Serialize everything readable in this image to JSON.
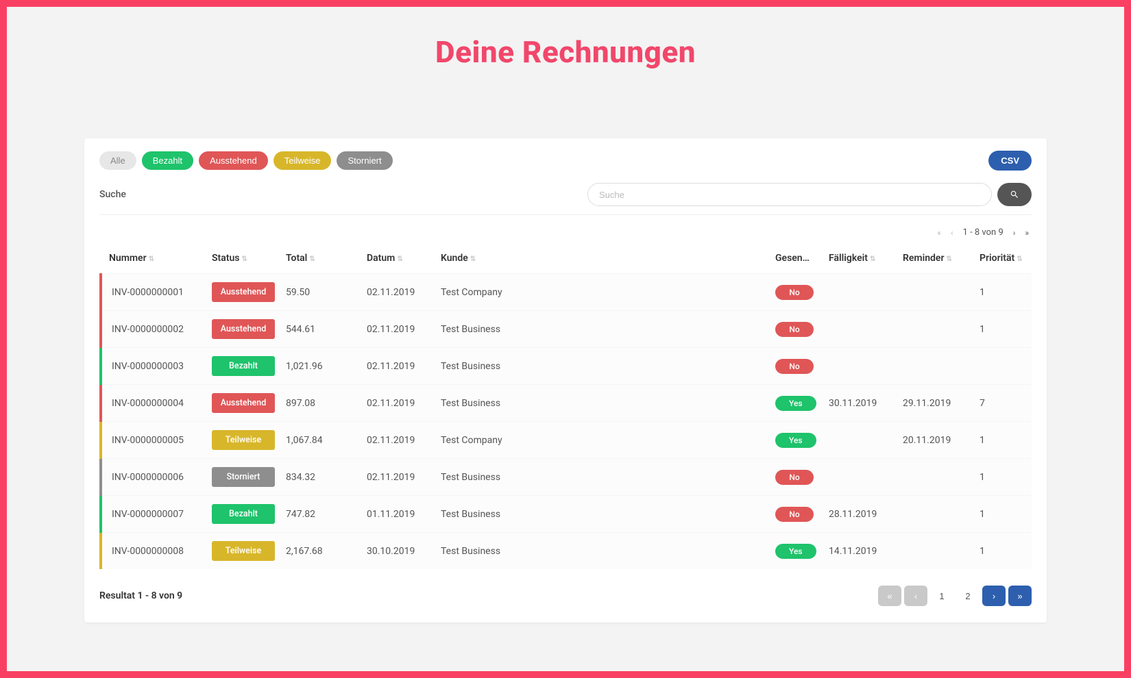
{
  "page": {
    "title": "Deine Rechnungen"
  },
  "filters": {
    "items": [
      {
        "label": "Alle",
        "style": "grey-light"
      },
      {
        "label": "Bezahlt",
        "style": "green"
      },
      {
        "label": "Ausstehend",
        "style": "red"
      },
      {
        "label": "Teilweise",
        "style": "yellow"
      },
      {
        "label": "Storniert",
        "style": "grey"
      }
    ],
    "csv_label": "CSV"
  },
  "search": {
    "label": "Suche",
    "placeholder": "Suche"
  },
  "pager_top": {
    "range_text": "1 - 8 von 9"
  },
  "columns": {
    "num": "Nummer",
    "status": "Status",
    "total": "Total",
    "date": "Datum",
    "customer": "Kunde",
    "sent": "Gesen…",
    "due": "Fälligkeit",
    "reminder": "Reminder",
    "priority": "Priorität"
  },
  "status_styles": {
    "Ausstehend": "red",
    "Bezahlt": "green",
    "Teilweise": "yellow",
    "Storniert": "grey"
  },
  "rows": [
    {
      "num": "INV-0000000001",
      "status": "Ausstehend",
      "total": "59.50",
      "date": "02.11.2019",
      "customer": "Test Company",
      "sent": "No",
      "due": "",
      "reminder": "",
      "priority": "1"
    },
    {
      "num": "INV-0000000002",
      "status": "Ausstehend",
      "total": "544.61",
      "date": "02.11.2019",
      "customer": "Test Business",
      "sent": "No",
      "due": "",
      "reminder": "",
      "priority": "1"
    },
    {
      "num": "INV-0000000003",
      "status": "Bezahlt",
      "total": "1,021.96",
      "date": "02.11.2019",
      "customer": "Test Business",
      "sent": "No",
      "due": "",
      "reminder": "",
      "priority": ""
    },
    {
      "num": "INV-0000000004",
      "status": "Ausstehend",
      "total": "897.08",
      "date": "02.11.2019",
      "customer": "Test Business",
      "sent": "Yes",
      "due": "30.11.2019",
      "reminder": "29.11.2019",
      "priority": "7"
    },
    {
      "num": "INV-0000000005",
      "status": "Teilweise",
      "total": "1,067.84",
      "date": "02.11.2019",
      "customer": "Test Company",
      "sent": "Yes",
      "due": "",
      "reminder": "20.11.2019",
      "priority": "1"
    },
    {
      "num": "INV-0000000006",
      "status": "Storniert",
      "total": "834.32",
      "date": "02.11.2019",
      "customer": "Test Business",
      "sent": "No",
      "due": "",
      "reminder": "",
      "priority": "1"
    },
    {
      "num": "INV-0000000007",
      "status": "Bezahlt",
      "total": "747.82",
      "date": "01.11.2019",
      "customer": "Test Business",
      "sent": "No",
      "due": "28.11.2019",
      "reminder": "",
      "priority": "1"
    },
    {
      "num": "INV-0000000008",
      "status": "Teilweise",
      "total": "2,167.68",
      "date": "30.10.2019",
      "customer": "Test Business",
      "sent": "Yes",
      "due": "14.11.2019",
      "reminder": "",
      "priority": "1"
    }
  ],
  "footer": {
    "result_text": "Resultat 1 - 8 von 9"
  },
  "pager_bottom": {
    "current": "1",
    "next": "2"
  }
}
